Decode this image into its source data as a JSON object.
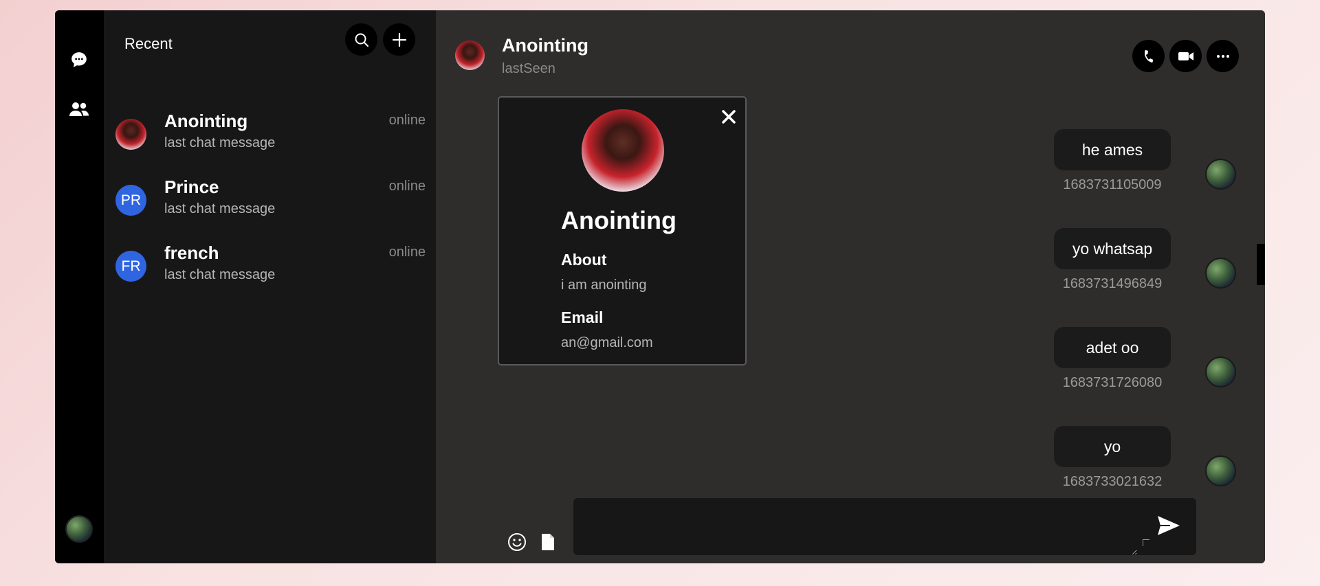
{
  "sidebar": {
    "title": "Recent",
    "chats": [
      {
        "name": "Anointing",
        "last_message": "last chat message",
        "status": "online",
        "avatar": "photo",
        "initials": ""
      },
      {
        "name": "Prince",
        "last_message": "last chat message",
        "status": "online",
        "avatar": "initials",
        "initials": "PR"
      },
      {
        "name": "french",
        "last_message": "last chat message",
        "status": "online",
        "avatar": "initials",
        "initials": "FR"
      }
    ]
  },
  "header": {
    "name": "Anointing",
    "subtitle": "lastSeen"
  },
  "messages": [
    {
      "text": "he ames",
      "timestamp": "1683731105009"
    },
    {
      "text": "yo whatsap",
      "timestamp": "1683731496849"
    },
    {
      "text": "adet oo",
      "timestamp": "1683731726080"
    },
    {
      "text": "yo",
      "timestamp": "1683733021632"
    }
  ],
  "profile": {
    "name": "Anointing",
    "about_label": "About",
    "about_value": "i am anointing",
    "email_label": "Email",
    "email_value": "an@gmail.com"
  },
  "composer": {
    "value": ""
  },
  "icons": {
    "rail": [
      "chat-bubble-icon",
      "users-icon"
    ],
    "sidebar": [
      "search-icon",
      "plus-icon"
    ],
    "header": [
      "phone-icon",
      "video-icon",
      "more-icon"
    ],
    "composer": [
      "emoji-icon",
      "file-icon",
      "send-icon"
    ],
    "profile": [
      "close-icon"
    ]
  },
  "colors": {
    "accent": "#2f65e0",
    "panel": "#181717",
    "chat_bg": "#2f2c2c"
  }
}
